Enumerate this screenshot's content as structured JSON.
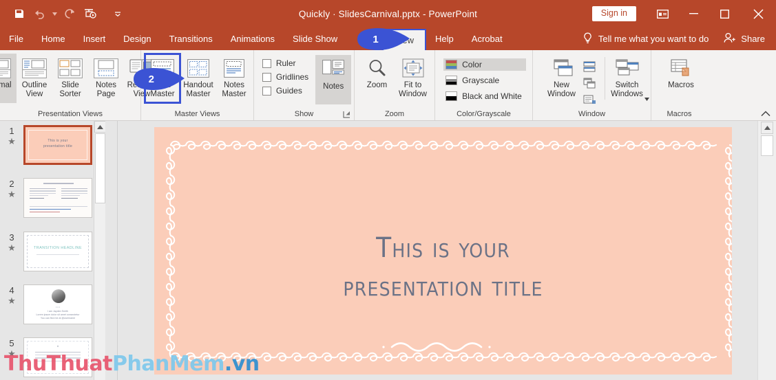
{
  "window": {
    "title": "Quickly · SlidesCarnival.pptx  -  PowerPoint",
    "sign_in_label": "Sign in",
    "accent_color": "#b7472a",
    "ribbon_bg": "#f3f2f1",
    "annotation_color": "#3b53d4",
    "quick_access": [
      {
        "name": "save-icon",
        "label": "Save"
      },
      {
        "name": "undo-icon",
        "label": "Undo"
      },
      {
        "name": "redo-icon",
        "label": "Redo"
      },
      {
        "name": "start-presentation-icon",
        "label": "Start From Beginning"
      },
      {
        "name": "customize-quick-access-icon",
        "label": "Customize Quick Access Toolbar"
      }
    ],
    "controls": [
      {
        "name": "ribbon-display-options-icon",
        "label": "Ribbon Display Options"
      },
      {
        "name": "minimize-icon",
        "label": "Minimize"
      },
      {
        "name": "maximize-icon",
        "label": "Maximize"
      },
      {
        "name": "close-icon",
        "label": "Close"
      }
    ]
  },
  "menubar": {
    "tabs": [
      {
        "label": "File",
        "active": false
      },
      {
        "label": "Home",
        "active": false
      },
      {
        "label": "Insert",
        "active": false
      },
      {
        "label": "Design",
        "active": false
      },
      {
        "label": "Transitions",
        "active": false
      },
      {
        "label": "Animations",
        "active": false
      },
      {
        "label": "Slide Show",
        "active": false
      },
      {
        "label": "View",
        "active": true
      },
      {
        "label": "Help",
        "active": false
      },
      {
        "label": "Acrobat",
        "active": false
      }
    ],
    "tell_me": "Tell me what you want to do",
    "share": "Share"
  },
  "ribbon": {
    "groups": [
      {
        "label": "Presentation Views",
        "buttons": [
          {
            "label": "Normal",
            "icon": "normal-view-icon",
            "selected": true
          },
          {
            "label": "Outline View",
            "icon": "outline-view-icon",
            "selected": false
          },
          {
            "label": "Slide Sorter",
            "icon": "slide-sorter-icon",
            "selected": false
          },
          {
            "label": "Notes Page",
            "icon": "notes-page-icon",
            "selected": false
          },
          {
            "label": "Reading View",
            "icon": "reading-view-icon",
            "selected": false
          }
        ]
      },
      {
        "label": "Master Views",
        "buttons": [
          {
            "label": "Slide Master",
            "icon": "slide-master-icon",
            "highlighted": true
          },
          {
            "label": "Handout Master",
            "icon": "handout-master-icon",
            "highlighted": false
          },
          {
            "label": "Notes Master",
            "icon": "notes-master-icon",
            "highlighted": false
          }
        ]
      },
      {
        "label": "Show",
        "checkboxes": [
          {
            "label": "Ruler",
            "checked": false
          },
          {
            "label": "Gridlines",
            "checked": false
          },
          {
            "label": "Guides",
            "checked": false
          }
        ],
        "buttons": [
          {
            "label": "Notes",
            "icon": "notes-icon",
            "selected": true
          }
        ],
        "has_dialog_launcher": true
      },
      {
        "label": "Zoom",
        "buttons": [
          {
            "label": "Zoom",
            "icon": "magnifier-icon",
            "selected": false
          },
          {
            "label": "Fit to Window",
            "icon": "fit-to-window-icon",
            "selected": false
          }
        ]
      },
      {
        "label": "Color/Grayscale",
        "options": [
          {
            "label": "Color",
            "icon": "color-swatch-icon",
            "selected": true
          },
          {
            "label": "Grayscale",
            "icon": "grayscale-swatch-icon",
            "selected": false
          },
          {
            "label": "Black and White",
            "icon": "black-white-swatch-icon",
            "selected": false
          }
        ]
      },
      {
        "label": "Window",
        "buttons": [
          {
            "label": "New Window",
            "icon": "new-window-icon"
          },
          {
            "label": "Switch Windows",
            "icon": "switch-windows-icon",
            "has_dropdown": true
          }
        ],
        "small_buttons": [
          {
            "label": "Arrange All",
            "icon": "arrange-all-icon"
          },
          {
            "label": "Cascade",
            "icon": "cascade-icon"
          },
          {
            "label": "Move Split",
            "icon": "move-split-icon"
          }
        ]
      },
      {
        "label": "Macros",
        "buttons": [
          {
            "label": "Macros",
            "icon": "macros-icon"
          }
        ]
      }
    ],
    "collapse_label": "Collapse the Ribbon"
  },
  "thumbnails": {
    "slides": [
      {
        "number": "1",
        "star": "★",
        "selected": true,
        "kind": "title"
      },
      {
        "number": "2",
        "star": "★",
        "selected": false,
        "kind": "twocol"
      },
      {
        "number": "3",
        "star": "★",
        "selected": false,
        "kind": "section"
      },
      {
        "number": "4",
        "star": "★",
        "selected": false,
        "kind": "photo"
      },
      {
        "number": "5",
        "star": "★",
        "selected": false,
        "kind": "table"
      }
    ]
  },
  "slide": {
    "title_line1": "This is your",
    "title_line2": "presentation title",
    "background_color": "#fbcdb9",
    "text_color": "#6b7286"
  },
  "annotations": [
    {
      "number": "1",
      "target": "view-tab"
    },
    {
      "number": "2",
      "target": "slide-master-button"
    }
  ],
  "watermark": {
    "part1": "ThuThuat",
    "part2": "PhanMem",
    "part3": ".vn"
  }
}
